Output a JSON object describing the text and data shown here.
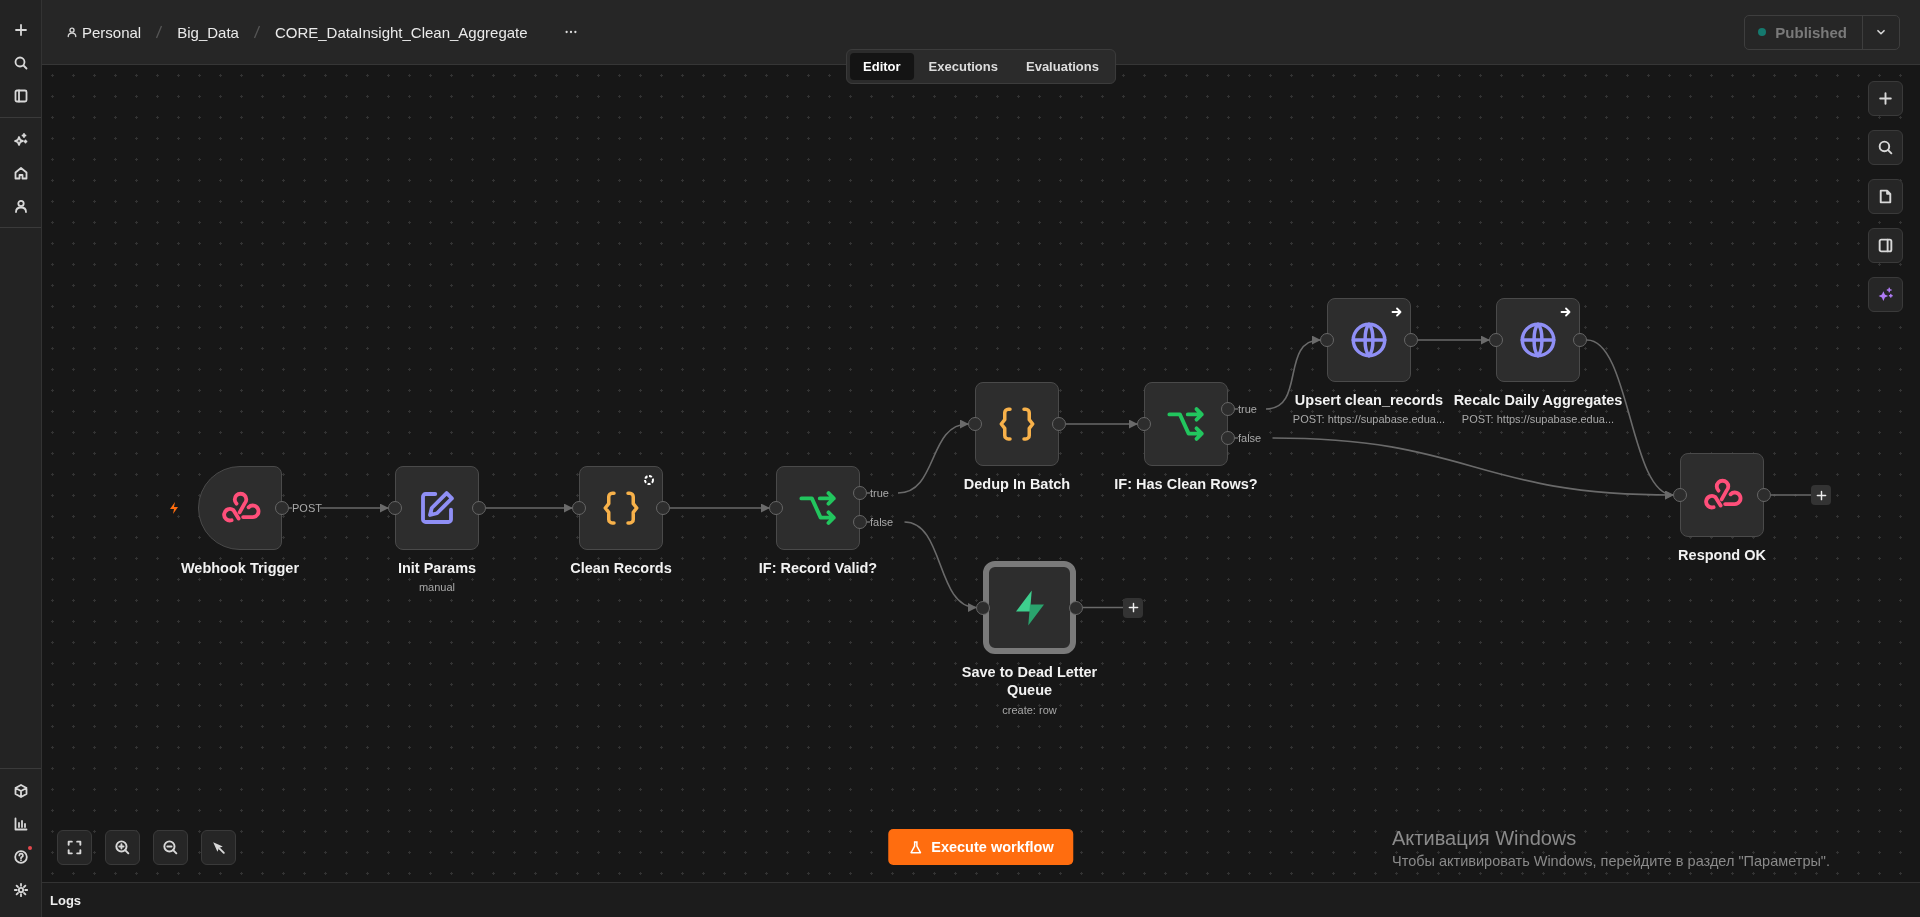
{
  "breadcrumb": [
    {
      "label": "Personal",
      "kind": "owner"
    },
    {
      "label": "Big_Data",
      "kind": "folder"
    },
    {
      "label": "CORE_DataInsight_Clean_Aggregate",
      "kind": "workflow"
    }
  ],
  "tabs": [
    {
      "label": "Editor",
      "selected": true
    },
    {
      "label": "Executions",
      "selected": false
    },
    {
      "label": "Evaluations",
      "selected": false
    }
  ],
  "publish": {
    "label": "Published",
    "disabled": true
  },
  "nodes": [
    {
      "name": "Webhook Trigger",
      "kind": "webhook",
      "trigger": true,
      "selected": false,
      "add_button": false,
      "outputs": [
        {
          "label": "POST"
        }
      ]
    },
    {
      "name": "Init Params",
      "subtitle": "manual",
      "kind": "edit",
      "trigger": false,
      "selected": false,
      "add_button": false
    },
    {
      "name": "Clean Records",
      "kind": "code",
      "corner_icon": {
        "kind": "sync"
      },
      "trigger": false,
      "selected": false,
      "add_button": false
    },
    {
      "name": "IF: Record Valid?",
      "kind": "if",
      "trigger": false,
      "selected": false,
      "add_button": false,
      "outputs": [
        {
          "label": "true"
        },
        {
          "label": "false"
        }
      ]
    },
    {
      "name": "Dedup In Batch",
      "kind": "code",
      "trigger": false,
      "selected": false,
      "add_button": false
    },
    {
      "name": "IF: Has Clean Rows?",
      "kind": "if",
      "trigger": false,
      "selected": false,
      "add_button": false,
      "outputs": [
        {
          "label": "true"
        },
        {
          "label": "false"
        }
      ]
    },
    {
      "name": "Upsert clean_records",
      "subtitle": "POST: https://supabase.edua...",
      "kind": "http",
      "corner_icon": {
        "kind": "arrow"
      },
      "trigger": false,
      "selected": false,
      "add_button": false
    },
    {
      "name": "Recalc Daily Aggregates",
      "subtitle": "POST: https://supabase.edua...",
      "kind": "http",
      "corner_icon": {
        "kind": "arrow"
      },
      "trigger": false,
      "selected": false,
      "add_button": false
    },
    {
      "name": "Respond OK",
      "kind": "webhook",
      "trigger": false,
      "selected": false,
      "add_button": true
    },
    {
      "name": "Save to Dead Letter Queue",
      "subtitle": "create: row",
      "kind": "supabase",
      "trigger": false,
      "selected": true,
      "add_button": true
    }
  ],
  "execute_button": {
    "label": "Execute workflow"
  },
  "os_notice": {
    "title": "Активация Windows",
    "text": "Чтобы активировать Windows, перейдите в раздел \"Параметры\"."
  },
  "logs_bar": {
    "label": "Logs"
  }
}
